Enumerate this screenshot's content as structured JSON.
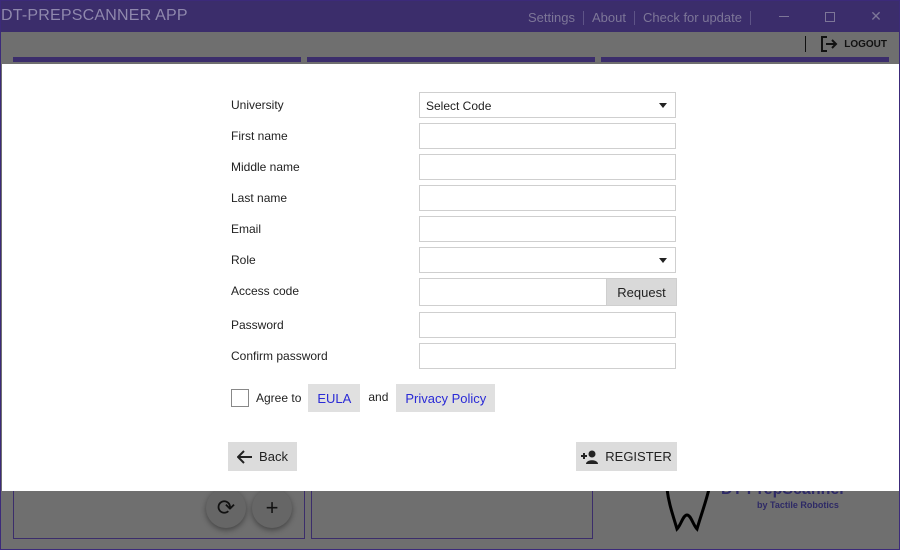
{
  "titlebar": {
    "app_title": "DT-PREPSCANNER APP",
    "menu": [
      "Settings",
      "About",
      "Check for update"
    ]
  },
  "toolbar": {
    "logout_label": "LOGOUT"
  },
  "form": {
    "university_label": "University",
    "university_value": "Select Code",
    "first_name_label": "First name",
    "first_name_value": "",
    "middle_name_label": "Middle name",
    "middle_name_value": "",
    "last_name_label": "Last name",
    "last_name_value": "",
    "email_label": "Email",
    "email_value": "",
    "role_label": "Role",
    "role_value": "",
    "access_code_label": "Access code",
    "access_code_value": "",
    "request_label": "Request",
    "password_label": "Password",
    "confirm_password_label": "Confirm password"
  },
  "agreement": {
    "agree_to": "Agree to",
    "eula": "EULA",
    "and": "and",
    "privacy_policy": "Privacy Policy",
    "checked": false
  },
  "actions": {
    "back_label": "Back",
    "register_label": "REGISTER"
  },
  "background": {
    "logo_text": "DT-PrepScanner",
    "logo_sub": "by Tactile Robotics"
  },
  "colors": {
    "titlebar": "#3b2d6b",
    "link": "#2a2ad6",
    "button_bg": "#dcdcdc"
  }
}
